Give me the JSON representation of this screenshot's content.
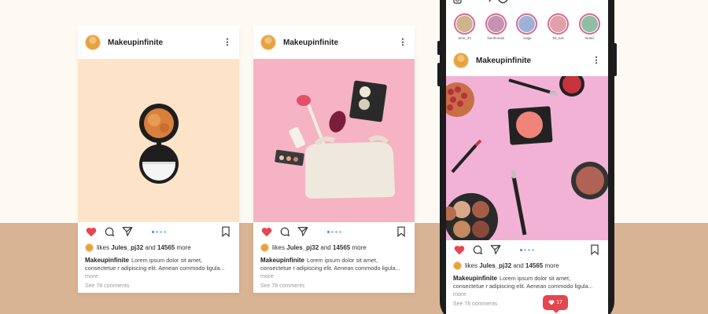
{
  "colors": {
    "background_top": "#fdfaf3",
    "background_bottom": "#d8b394",
    "like_red": "#e5464d",
    "dot_blue": "#3f8fcf",
    "photo1_bg": "#fde4c8",
    "photo2_bg": "#f5b3c3",
    "photo3_bg": "#f2b2d6"
  },
  "cards": [
    {
      "username": "Makeupinfinite",
      "likes_prefix": "likes",
      "likes_user": "Jules_pj32",
      "likes_and": "and",
      "likes_count": "14565",
      "likes_suffix": "more",
      "caption_user": "Makeupinfinite",
      "caption_text": "Lorem ipsum dolor sit amet, consectetue r adipiscing elit. Aenean commodo ligula...",
      "more_label": "more",
      "comments": "See 78 comments",
      "liked": true,
      "photo_icon": "compact-powder-icon"
    },
    {
      "username": "Makeupinfinite",
      "likes_prefix": "likes",
      "likes_user": "Jules_pj32",
      "likes_and": "and",
      "likes_count": "14565",
      "likes_suffix": "more",
      "caption_user": "Makeupinfinite",
      "caption_text": "Lorem ipsum dolor sit amet, consectetue r adipiscing elit. Aenean commodo ligula...",
      "more_label": "more",
      "comments": "See 78 comments",
      "liked": true,
      "photo_icon": "makeup-bag-icon"
    }
  ],
  "phone": {
    "stories": [
      {
        "name": "ame_20",
        "color": "#cdb48b"
      },
      {
        "name": "liamhomas",
        "color": "#c692b3"
      },
      {
        "name": "noiga",
        "color": "#9eb2d6"
      },
      {
        "name": "56_luis",
        "color": "#e0a0aa"
      },
      {
        "name": "lorald",
        "color": "#8ebfa4"
      }
    ],
    "post": {
      "username": "Makeupinfinite",
      "likes_prefix": "likes",
      "likes_user": "Jules_pj32",
      "likes_and": "and",
      "likes_count": "14565",
      "likes_suffix": "more",
      "caption_user": "Makeupinfinite",
      "caption_text": "Lorem ipsum dolor sit amet, consectetue r adipiscing elit. Aenean commodo ligula...",
      "more_label": "more",
      "comments": "See 78 comments",
      "photo_icon": "makeup-flatlay-icon"
    },
    "notification": {
      "count": "17",
      "icon": "heart-icon"
    }
  }
}
